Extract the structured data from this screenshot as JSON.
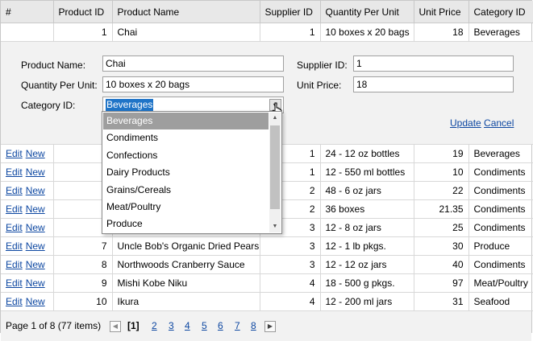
{
  "columns": [
    "#",
    "Product ID",
    "Product Name",
    "Supplier ID",
    "Quantity Per Unit",
    "Unit Price",
    "Category ID"
  ],
  "first_row": {
    "id": "1",
    "name": "Chai",
    "supplier": "1",
    "qty": "10 boxes x 20 bags",
    "price": "18",
    "category": "Beverages"
  },
  "edit_form": {
    "product_name_label": "Product Name:",
    "product_name_value": "Chai",
    "qty_label": "Quantity Per Unit:",
    "qty_value": "10 boxes x 20 bags",
    "category_label": "Category ID:",
    "category_value": "Beverages",
    "supplier_label": "Supplier ID:",
    "supplier_value": "1",
    "price_label": "Unit Price:",
    "price_value": "18",
    "update_label": "Update",
    "cancel_label": "Cancel"
  },
  "dropdown_options": [
    "Beverages",
    "Condiments",
    "Confections",
    "Dairy Products",
    "Grains/Cereals",
    "Meat/Poultry",
    "Produce"
  ],
  "command_labels": {
    "edit": "Edit",
    "new": "New"
  },
  "rows": [
    {
      "id": "",
      "name": "",
      "supplier": "1",
      "qty": "24 - 12 oz bottles",
      "price": "19",
      "category": "Beverages"
    },
    {
      "id": "",
      "name": "",
      "supplier": "1",
      "qty": "12 - 550 ml bottles",
      "price": "10",
      "category": "Condiments"
    },
    {
      "id": "",
      "name": "",
      "supplier": "2",
      "qty": "48 - 6 oz jars",
      "price": "22",
      "category": "Condiments"
    },
    {
      "id": "",
      "name": "",
      "supplier": "2",
      "qty": "36 boxes",
      "price": "21.35",
      "category": "Condiments"
    },
    {
      "id": "",
      "name": "",
      "supplier": "3",
      "qty": "12 - 8 oz jars",
      "price": "25",
      "category": "Condiments"
    },
    {
      "id": "7",
      "name": "Uncle Bob's Organic Dried Pears",
      "supplier": "3",
      "qty": "12 - 1 lb pkgs.",
      "price": "30",
      "category": "Produce"
    },
    {
      "id": "8",
      "name": "Northwoods Cranberry Sauce",
      "supplier": "3",
      "qty": "12 - 12 oz jars",
      "price": "40",
      "category": "Condiments"
    },
    {
      "id": "9",
      "name": "Mishi Kobe Niku",
      "supplier": "4",
      "qty": "18 - 500 g pkgs.",
      "price": "97",
      "category": "Meat/Poultry"
    },
    {
      "id": "10",
      "name": "Ikura",
      "supplier": "4",
      "qty": "12 - 200 ml jars",
      "price": "31",
      "category": "Seafood"
    }
  ],
  "pager": {
    "summary": "Page 1 of 8 (77 items)",
    "pages": [
      "[1]",
      "2",
      "3",
      "4",
      "5",
      "6",
      "7",
      "8"
    ]
  }
}
